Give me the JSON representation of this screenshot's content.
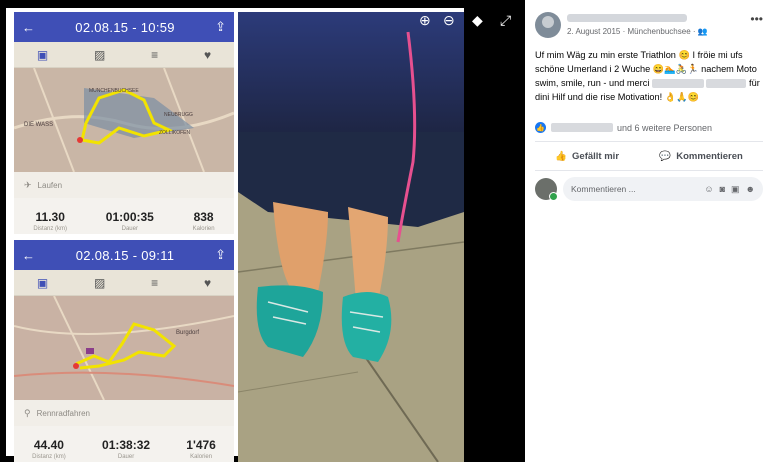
{
  "viewer": {
    "card_top": {
      "datetime": "02.08.15 - 10:59",
      "activity": "Laufen",
      "stats": [
        {
          "value": "11.30",
          "label": "Distanz (km)"
        },
        {
          "value": "01:00:35",
          "label": "Dauer"
        },
        {
          "value": "838",
          "label": "Kalorien"
        }
      ],
      "map_labels": [
        "DIE WASS",
        "MUNCHENBUCHSEE",
        "NEUBRUGG",
        "ZOLLIKOFEN"
      ]
    },
    "card_bottom": {
      "datetime": "02.08.15 - 09:11",
      "activity": "Rennradfahren",
      "stats": [
        {
          "value": "44.40",
          "label": "Distanz (km)"
        },
        {
          "value": "01:38:32",
          "label": "Dauer"
        },
        {
          "value": "1'476",
          "label": "Kalorien"
        }
      ],
      "map_labels": [
        "Burgdorf"
      ]
    },
    "icons": {
      "back": "←",
      "share": "⇪",
      "zoom_in": "⊕",
      "zoom_out": "⊖",
      "tag": "◆",
      "expand": "⤢"
    }
  },
  "post": {
    "date": "2. August 2015",
    "location": "Münchenbuchsee",
    "privacy_icon": "friends-icon",
    "text_1": "Uf mim Wäg zu min erste Triathlon",
    "text_2": " I fröie mi ufs schöne Umerland i 2 Wuche",
    "text_3": " nachem Moto swim, smile, run - und merci ",
    "text_4": " für dini Hilf und die rise Motivation!",
    "reactions_text": "und 6 weitere Personen",
    "like_label": "Gefällt mir",
    "comment_label": "Kommentieren",
    "comment_placeholder": "Kommentieren ..."
  },
  "colors": {
    "appbar": "#3f4fb6",
    "route": "#f2e300",
    "fb_blue": "#1877f2"
  }
}
